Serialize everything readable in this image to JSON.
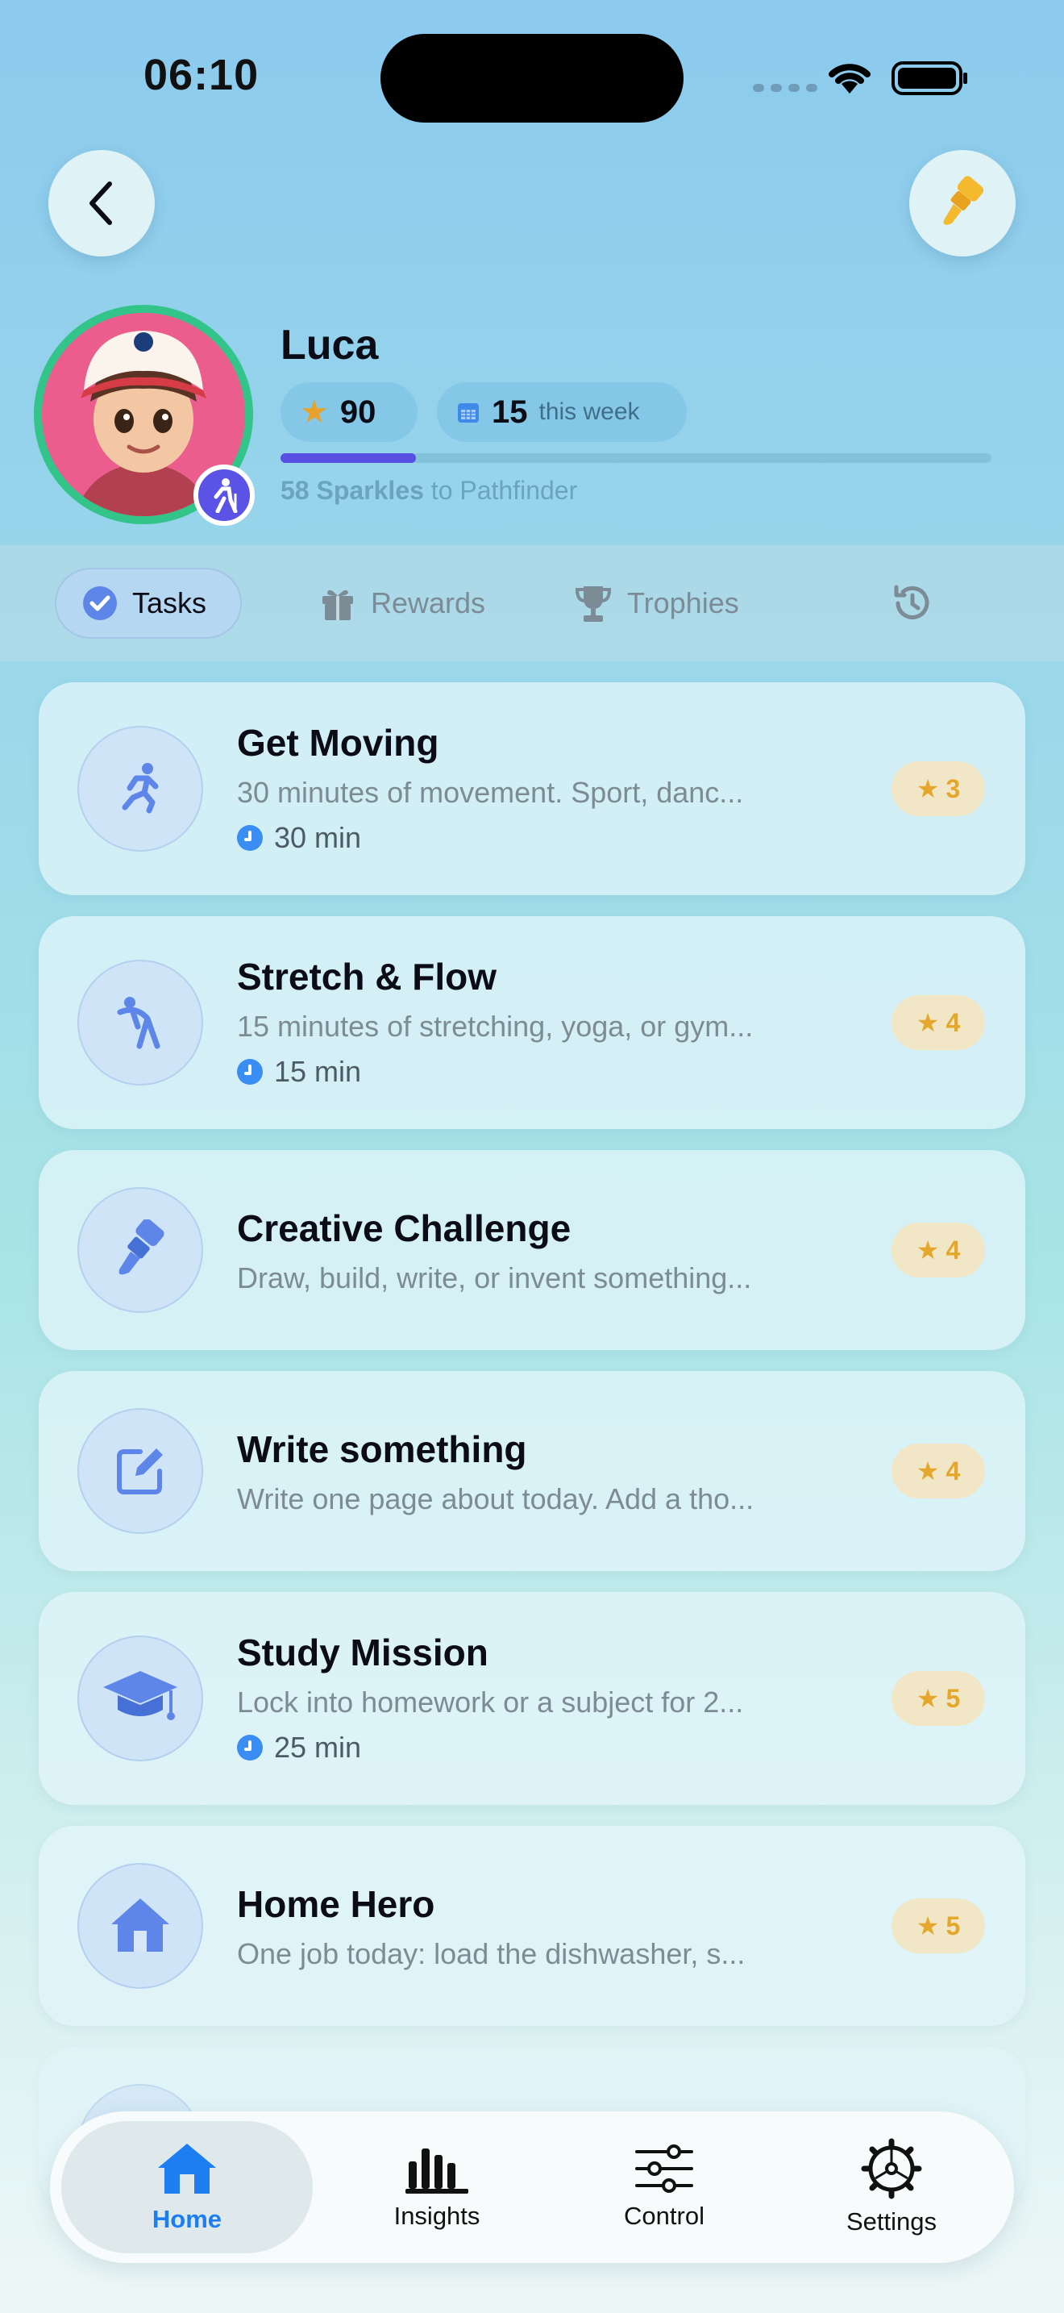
{
  "status_bar": {
    "time": "06:10"
  },
  "profile": {
    "name": "Luca",
    "stars": "90",
    "week_count": "15",
    "week_label": "this week",
    "progress_fraction": 0.19,
    "progress_bold": "58 Sparkles",
    "progress_rest": "to Pathfinder"
  },
  "tabs": [
    {
      "label": "Tasks",
      "active": true
    },
    {
      "label": "Rewards"
    },
    {
      "label": "Trophies"
    },
    {
      "label": "history-icon"
    }
  ],
  "tasks": [
    {
      "title": "Get Moving",
      "description": "30 minutes of movement. Sport, danc...",
      "duration": "30 min",
      "reward": "3",
      "icon": "running-icon"
    },
    {
      "title": "Stretch & Flow",
      "description": "15 minutes of stretching, yoga, or gym...",
      "duration": "15 min",
      "reward": "4",
      "icon": "stretch-icon"
    },
    {
      "title": "Creative Challenge",
      "description": "Draw, build, write, or invent something...",
      "reward": "4",
      "icon": "paintbrush-icon"
    },
    {
      "title": "Write something",
      "description": "Write one page about today. Add a tho...",
      "reward": "4",
      "icon": "pencil-square-icon"
    },
    {
      "title": "Study Mission",
      "description": "Lock into homework or a subject for 2...",
      "duration": "25 min",
      "reward": "5",
      "icon": "graduation-cap-icon"
    },
    {
      "title": "Home Hero",
      "description": "One job today: load the dishwasher, s...",
      "reward": "5",
      "icon": "house-icon"
    }
  ],
  "bottom_nav": [
    {
      "label": "Home",
      "active": true
    },
    {
      "label": "Insights"
    },
    {
      "label": "Control"
    },
    {
      "label": "Settings"
    }
  ],
  "colors": {
    "accent": "#1c7ef0",
    "progress": "#5a4fe3",
    "star": "#e4a72b",
    "avatar_ring": "#33c48a"
  }
}
